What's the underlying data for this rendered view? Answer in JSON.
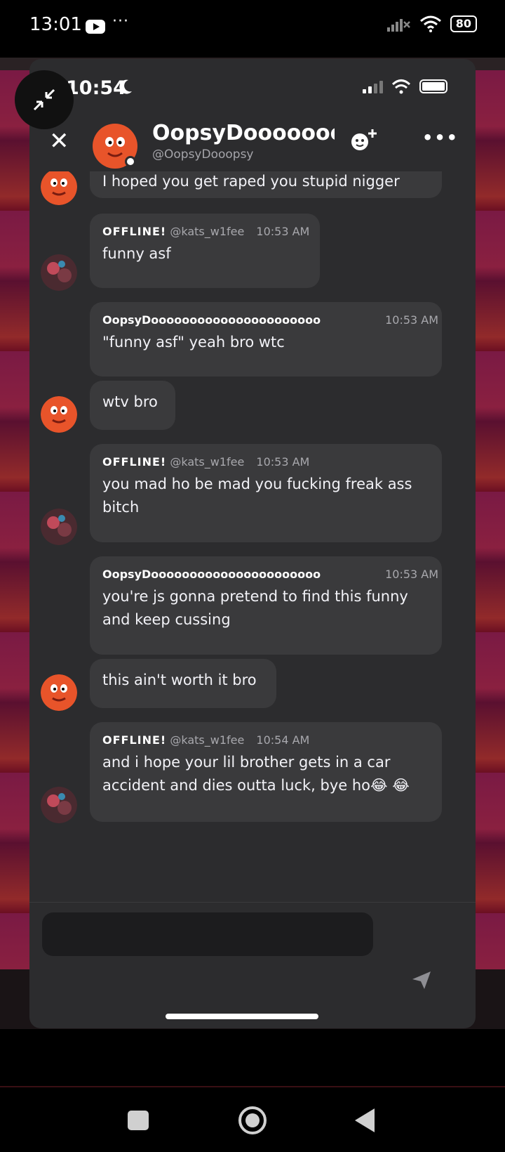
{
  "phone_status": {
    "time": "13:01",
    "more": "···",
    "battery": "80"
  },
  "inner_status": {
    "time": "10:54"
  },
  "header": {
    "name": "OopsyDoooooooooooooooooooooo",
    "handle": "@OopsyDooopsy"
  },
  "messages": [
    {
      "kind": "partial",
      "text": "I hoped you get raped you stupid nigger",
      "avatar": "gumball"
    },
    {
      "kind": "full",
      "author_tag": "OFFLINE!",
      "author_handle": "@kats_w1fee",
      "time": "10:53 AM",
      "text": "funny asf",
      "avatar": "kat"
    },
    {
      "kind": "full",
      "author": "OopsyDoooooooooooooooooooooo",
      "time": "10:53 AM",
      "text": "\"funny asf\" yeah bro wtc"
    },
    {
      "kind": "cont",
      "text": "wtv bro",
      "avatar": "gumball"
    },
    {
      "kind": "full",
      "author_tag": "OFFLINE!",
      "author_handle": "@kats_w1fee",
      "time": "10:53 AM",
      "text": "you mad ho be mad you fucking freak ass bitch",
      "avatar": "kat"
    },
    {
      "kind": "full",
      "author": "OopsyDoooooooooooooooooooooo",
      "time": "10:53 AM",
      "text": "you're js gonna pretend to find this funny and keep cussing"
    },
    {
      "kind": "cont",
      "text": "this ain't worth it bro",
      "avatar": "gumball"
    },
    {
      "kind": "full",
      "author_tag": "OFFLINE!",
      "author_handle": "@kats_w1fee",
      "time": "10:54 AM",
      "text": "and i hope your lil brother gets in a car accident and dies outta luck, bye ho😂 😂",
      "avatar": "kat"
    }
  ],
  "colors": {
    "card_bg": "#2c2c2e",
    "bubble_bg": "#3a3a3c",
    "input_bg": "#1c1c1e",
    "muted_text": "#a8a8ad"
  }
}
